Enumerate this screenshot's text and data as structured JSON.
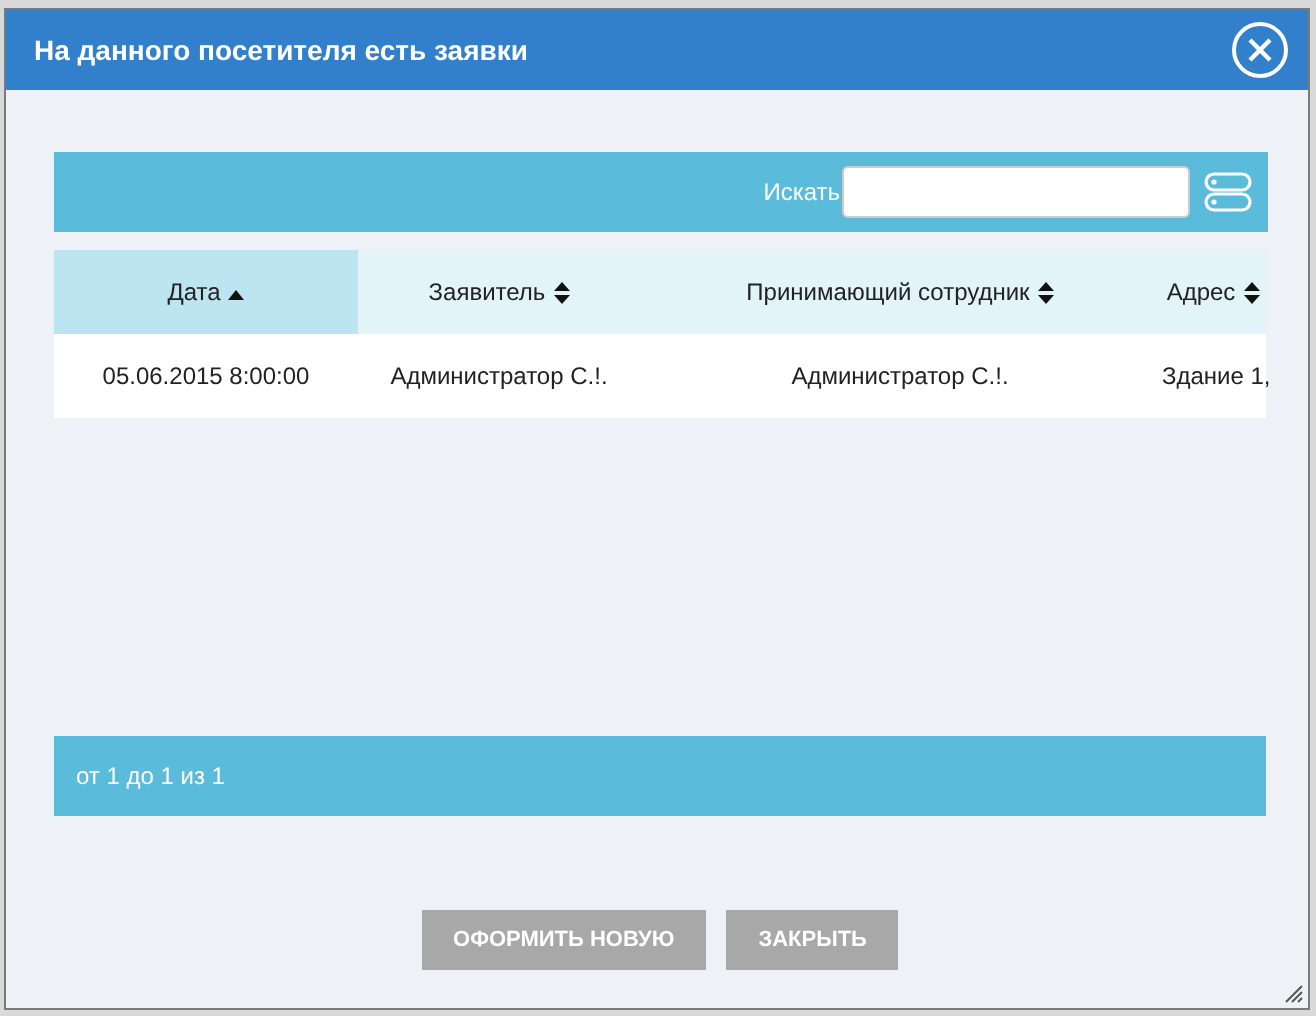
{
  "dialog": {
    "title": "На данного посетителя есть заявки"
  },
  "search": {
    "label": "Искать"
  },
  "table": {
    "columns": [
      {
        "label": "Дата",
        "kind": "sorted-asc",
        "selected": true
      },
      {
        "label": "Заявитель",
        "kind": "sortable",
        "selected": false
      },
      {
        "label": "Принимающий сотрудник",
        "kind": "sortable",
        "selected": false
      },
      {
        "label": "Адрес",
        "kind": "sortable",
        "selected": false
      }
    ],
    "rows": [
      [
        "05.06.2015 8:00:00",
        "Администратор С.!.",
        "Администратор С.!.",
        "Здание 1,"
      ]
    ]
  },
  "pagination": {
    "info": "от 1 до 1 из 1"
  },
  "buttons": [
    "ОФОРМИТЬ НОВУЮ",
    "ЗАКРЫТЬ"
  ]
}
